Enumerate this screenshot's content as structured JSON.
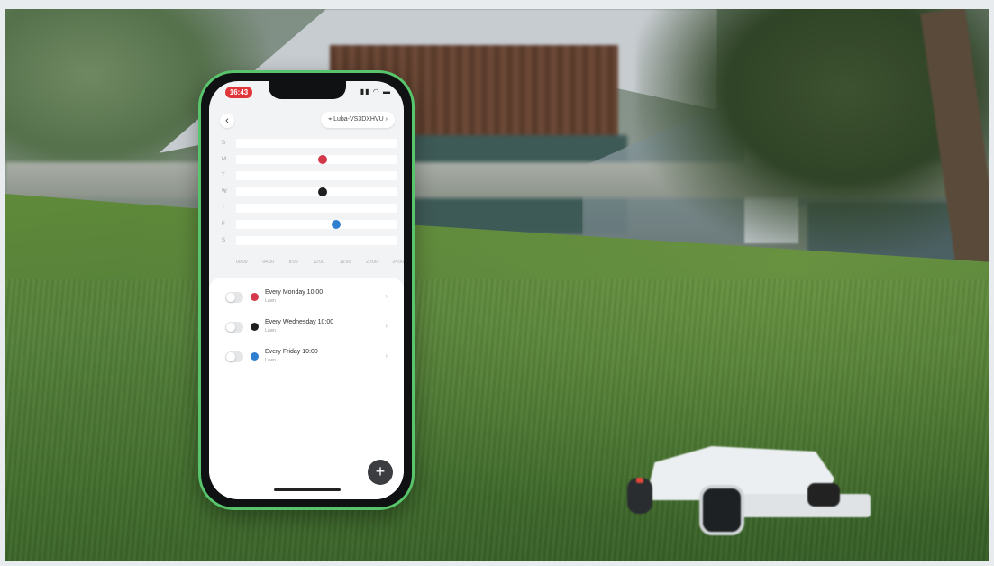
{
  "colors": {
    "phone_border": "#58c46b",
    "dot_red": "#d3394a",
    "dot_black": "#1f1f1f",
    "dot_blue": "#2f7fd0",
    "time_pill": "#e0363a"
  },
  "phone": {
    "status_time": "16:43",
    "status_icons": "signal wifi battery",
    "back_label": "‹",
    "device_name": "Luba-VS3DXHVU ›",
    "device_icon": "location-pin-icon"
  },
  "week": {
    "days": [
      "S",
      "M",
      "T",
      "W",
      "T",
      "F",
      "S"
    ],
    "hours": [
      "00:00",
      "04:00",
      "8:00",
      "12:00",
      "16:00",
      "20:00",
      "24:00"
    ],
    "marks": [
      {
        "day_index": 1,
        "hour": 13,
        "color": "dot_red"
      },
      {
        "day_index": 3,
        "hour": 13,
        "color": "dot_black"
      },
      {
        "day_index": 5,
        "hour": 15,
        "color": "dot_blue"
      }
    ]
  },
  "tasks": [
    {
      "title": "Every Monday 10:00",
      "subtitle": "Lawn",
      "color": "dot_red",
      "enabled": false
    },
    {
      "title": "Every Wednesday 10:00",
      "subtitle": "Lawn",
      "color": "dot_black",
      "enabled": false
    },
    {
      "title": "Every Friday 10:00",
      "subtitle": "Lawn",
      "color": "dot_blue",
      "enabled": false
    }
  ],
  "fab_label": "+"
}
